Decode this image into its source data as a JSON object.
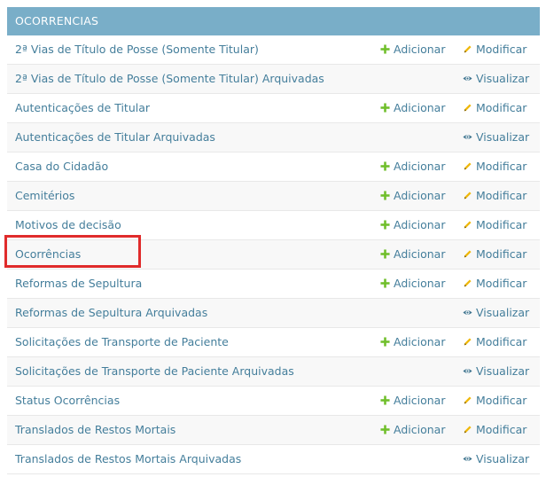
{
  "module": {
    "caption": "OCORRENCIAS",
    "add_label": "Adicionar",
    "change_label": "Modificar",
    "view_label": "Visualizar",
    "icons": {
      "add": "plus-icon",
      "change": "pencil-icon",
      "view": "eye-icon"
    },
    "colors": {
      "header_bg": "#79aec8",
      "link": "#447e9b",
      "add_icon": "#70bf2b",
      "change_icon": "#efb80b",
      "view_icon": "#417690",
      "highlight": "#e02b2b"
    },
    "rows": [
      {
        "label": "2ª Vias de Título de Posse (Somente Titular)",
        "actions": "add-change"
      },
      {
        "label": "2ª Vias de Título de Posse (Somente Titular) Arquivadas",
        "actions": "view"
      },
      {
        "label": "Autenticações de Titular",
        "actions": "add-change"
      },
      {
        "label": "Autenticações de Titular Arquivadas",
        "actions": "view"
      },
      {
        "label": "Casa do Cidadão",
        "actions": "add-change"
      },
      {
        "label": "Cemitérios",
        "actions": "add-change"
      },
      {
        "label": "Motivos de decisão",
        "actions": "add-change"
      },
      {
        "label": "Ocorrências",
        "actions": "add-change",
        "highlighted": true
      },
      {
        "label": "Reformas de Sepultura",
        "actions": "add-change"
      },
      {
        "label": "Reformas de Sepultura Arquivadas",
        "actions": "view"
      },
      {
        "label": "Solicitações de Transporte de Paciente",
        "actions": "add-change"
      },
      {
        "label": "Solicitações de Transporte de Paciente Arquivadas",
        "actions": "view"
      },
      {
        "label": "Status Ocorrências",
        "actions": "add-change"
      },
      {
        "label": "Translados de Restos Mortais",
        "actions": "add-change"
      },
      {
        "label": "Translados de Restos Mortais Arquivadas",
        "actions": "view"
      }
    ]
  }
}
